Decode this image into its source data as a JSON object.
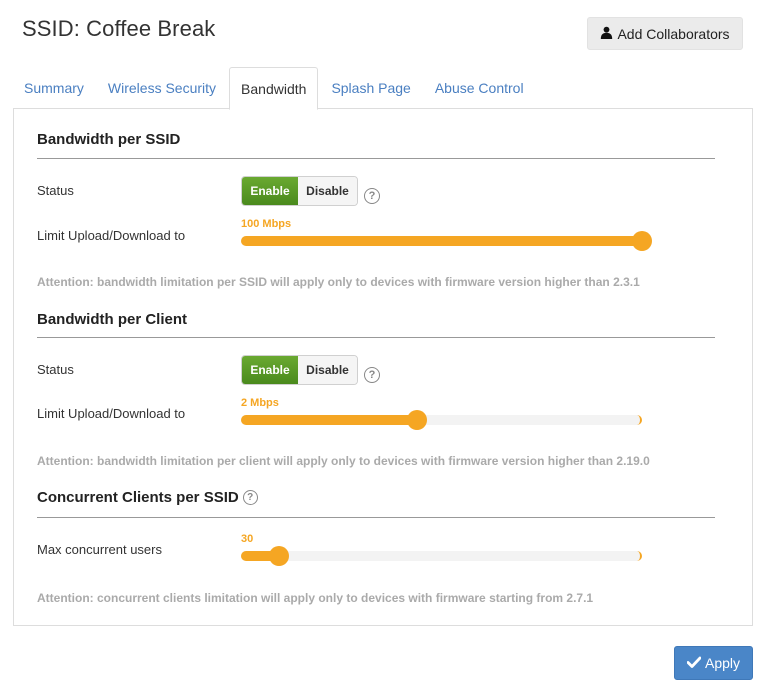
{
  "header": {
    "title": "SSID: Coffee Break",
    "add_collaborators_label": "Add Collaborators",
    "add_collaborators_icon": "user-icon"
  },
  "tabs": [
    {
      "label": "Summary",
      "active": false
    },
    {
      "label": "Wireless Security",
      "active": false
    },
    {
      "label": "Bandwidth",
      "active": true
    },
    {
      "label": "Splash Page",
      "active": false
    },
    {
      "label": "Abuse Control",
      "active": false
    }
  ],
  "sections": {
    "per_ssid": {
      "title": "Bandwidth per SSID",
      "status_label": "Status",
      "enable_label": "Enable",
      "disable_label": "Disable",
      "status": "Enable",
      "help_icon": "?",
      "limit_label": "Limit Upload/Download to",
      "limit_value": "100 Mbps",
      "slider_fraction": 1.0,
      "note": "Attention: bandwidth limitation per SSID will apply only to devices with firmware version higher than 2.3.1"
    },
    "per_client": {
      "title": "Bandwidth per Client",
      "status_label": "Status",
      "enable_label": "Enable",
      "disable_label": "Disable",
      "status": "Enable",
      "help_icon": "?",
      "limit_label": "Limit Upload/Download to",
      "limit_value": "2 Mbps",
      "slider_fraction": 0.44,
      "note": "Attention: bandwidth limitation per client will apply only to devices with firmware version higher than 2.19.0"
    },
    "concurrent": {
      "title": "Concurrent Clients per SSID",
      "help_icon": "?",
      "max_label": "Max concurrent users",
      "max_value": "30",
      "slider_fraction": 0.095,
      "note": "Attention: concurrent clients limitation will apply only to devices with firmware starting from 2.7.1"
    }
  },
  "footer": {
    "apply_label": "Apply",
    "apply_icon": "check-icon"
  },
  "colors": {
    "accent_orange": "#f5a623",
    "enable_green": "#5a9a26",
    "link_blue": "#4a7fc1",
    "apply_blue": "#4a86c8"
  }
}
